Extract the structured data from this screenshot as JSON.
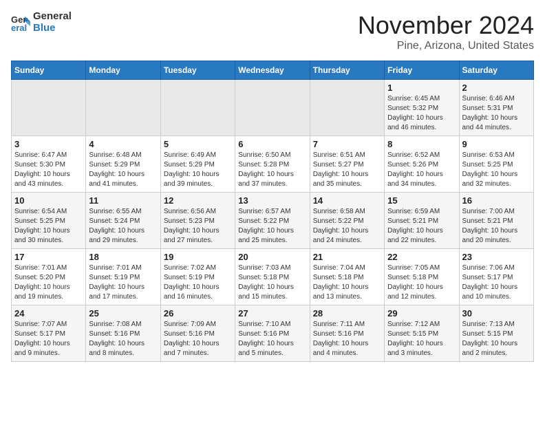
{
  "logo": {
    "line1": "General",
    "line2": "Blue"
  },
  "title": "November 2024",
  "location": "Pine, Arizona, United States",
  "headers": [
    "Sunday",
    "Monday",
    "Tuesday",
    "Wednesday",
    "Thursday",
    "Friday",
    "Saturday"
  ],
  "weeks": [
    [
      {
        "day": "",
        "info": ""
      },
      {
        "day": "",
        "info": ""
      },
      {
        "day": "",
        "info": ""
      },
      {
        "day": "",
        "info": ""
      },
      {
        "day": "",
        "info": ""
      },
      {
        "day": "1",
        "info": "Sunrise: 6:45 AM\nSunset: 5:32 PM\nDaylight: 10 hours\nand 46 minutes."
      },
      {
        "day": "2",
        "info": "Sunrise: 6:46 AM\nSunset: 5:31 PM\nDaylight: 10 hours\nand 44 minutes."
      }
    ],
    [
      {
        "day": "3",
        "info": "Sunrise: 6:47 AM\nSunset: 5:30 PM\nDaylight: 10 hours\nand 43 minutes."
      },
      {
        "day": "4",
        "info": "Sunrise: 6:48 AM\nSunset: 5:29 PM\nDaylight: 10 hours\nand 41 minutes."
      },
      {
        "day": "5",
        "info": "Sunrise: 6:49 AM\nSunset: 5:29 PM\nDaylight: 10 hours\nand 39 minutes."
      },
      {
        "day": "6",
        "info": "Sunrise: 6:50 AM\nSunset: 5:28 PM\nDaylight: 10 hours\nand 37 minutes."
      },
      {
        "day": "7",
        "info": "Sunrise: 6:51 AM\nSunset: 5:27 PM\nDaylight: 10 hours\nand 35 minutes."
      },
      {
        "day": "8",
        "info": "Sunrise: 6:52 AM\nSunset: 5:26 PM\nDaylight: 10 hours\nand 34 minutes."
      },
      {
        "day": "9",
        "info": "Sunrise: 6:53 AM\nSunset: 5:25 PM\nDaylight: 10 hours\nand 32 minutes."
      }
    ],
    [
      {
        "day": "10",
        "info": "Sunrise: 6:54 AM\nSunset: 5:25 PM\nDaylight: 10 hours\nand 30 minutes."
      },
      {
        "day": "11",
        "info": "Sunrise: 6:55 AM\nSunset: 5:24 PM\nDaylight: 10 hours\nand 29 minutes."
      },
      {
        "day": "12",
        "info": "Sunrise: 6:56 AM\nSunset: 5:23 PM\nDaylight: 10 hours\nand 27 minutes."
      },
      {
        "day": "13",
        "info": "Sunrise: 6:57 AM\nSunset: 5:22 PM\nDaylight: 10 hours\nand 25 minutes."
      },
      {
        "day": "14",
        "info": "Sunrise: 6:58 AM\nSunset: 5:22 PM\nDaylight: 10 hours\nand 24 minutes."
      },
      {
        "day": "15",
        "info": "Sunrise: 6:59 AM\nSunset: 5:21 PM\nDaylight: 10 hours\nand 22 minutes."
      },
      {
        "day": "16",
        "info": "Sunrise: 7:00 AM\nSunset: 5:21 PM\nDaylight: 10 hours\nand 20 minutes."
      }
    ],
    [
      {
        "day": "17",
        "info": "Sunrise: 7:01 AM\nSunset: 5:20 PM\nDaylight: 10 hours\nand 19 minutes."
      },
      {
        "day": "18",
        "info": "Sunrise: 7:01 AM\nSunset: 5:19 PM\nDaylight: 10 hours\nand 17 minutes."
      },
      {
        "day": "19",
        "info": "Sunrise: 7:02 AM\nSunset: 5:19 PM\nDaylight: 10 hours\nand 16 minutes."
      },
      {
        "day": "20",
        "info": "Sunrise: 7:03 AM\nSunset: 5:18 PM\nDaylight: 10 hours\nand 15 minutes."
      },
      {
        "day": "21",
        "info": "Sunrise: 7:04 AM\nSunset: 5:18 PM\nDaylight: 10 hours\nand 13 minutes."
      },
      {
        "day": "22",
        "info": "Sunrise: 7:05 AM\nSunset: 5:18 PM\nDaylight: 10 hours\nand 12 minutes."
      },
      {
        "day": "23",
        "info": "Sunrise: 7:06 AM\nSunset: 5:17 PM\nDaylight: 10 hours\nand 10 minutes."
      }
    ],
    [
      {
        "day": "24",
        "info": "Sunrise: 7:07 AM\nSunset: 5:17 PM\nDaylight: 10 hours\nand 9 minutes."
      },
      {
        "day": "25",
        "info": "Sunrise: 7:08 AM\nSunset: 5:16 PM\nDaylight: 10 hours\nand 8 minutes."
      },
      {
        "day": "26",
        "info": "Sunrise: 7:09 AM\nSunset: 5:16 PM\nDaylight: 10 hours\nand 7 minutes."
      },
      {
        "day": "27",
        "info": "Sunrise: 7:10 AM\nSunset: 5:16 PM\nDaylight: 10 hours\nand 5 minutes."
      },
      {
        "day": "28",
        "info": "Sunrise: 7:11 AM\nSunset: 5:16 PM\nDaylight: 10 hours\nand 4 minutes."
      },
      {
        "day": "29",
        "info": "Sunrise: 7:12 AM\nSunset: 5:15 PM\nDaylight: 10 hours\nand 3 minutes."
      },
      {
        "day": "30",
        "info": "Sunrise: 7:13 AM\nSunset: 5:15 PM\nDaylight: 10 hours\nand 2 minutes."
      }
    ]
  ]
}
